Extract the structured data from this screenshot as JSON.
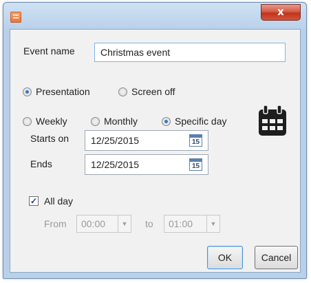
{
  "titlebar": {
    "close_label": "x"
  },
  "event": {
    "name_label": "Event name",
    "name_value": "Christmas event"
  },
  "mode": {
    "options": [
      "Presentation",
      "Screen off"
    ],
    "selected": "Presentation"
  },
  "recurrence": {
    "options": [
      "Weekly",
      "Monthly",
      "Specific day"
    ],
    "selected": "Specific day"
  },
  "dates": {
    "starts_label": "Starts on",
    "starts_value": "12/25/2015",
    "ends_label": "Ends",
    "ends_value": "12/25/2015",
    "calendar_day": "15"
  },
  "allday": {
    "label": "All day",
    "checked": true
  },
  "time": {
    "from_label": "From",
    "from_value": "00:00",
    "to_label": "to",
    "to_value": "01:00"
  },
  "buttons": {
    "ok": "OK",
    "cancel": "Cancel"
  },
  "icons": {
    "app": "app-icon",
    "calendar": "calendar-icon",
    "dropdown": "chevron-down-icon"
  },
  "colors": {
    "radio_accent": "#2f79c7",
    "input_focus_border": "#7eb4ea",
    "close_red": "#c2341c"
  }
}
